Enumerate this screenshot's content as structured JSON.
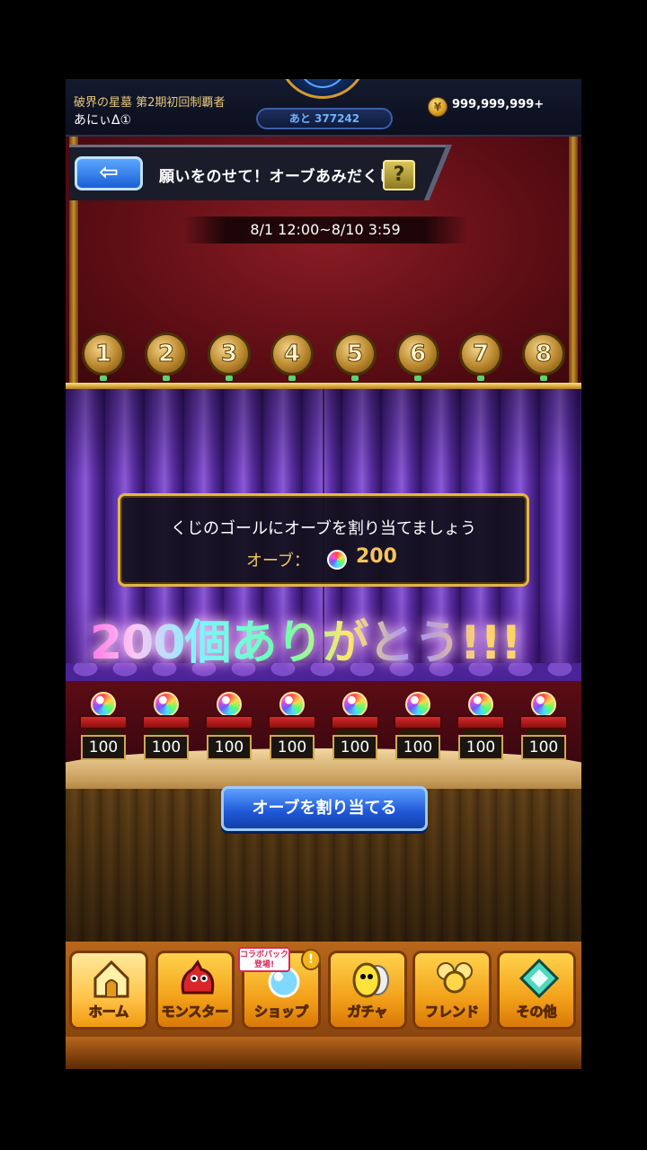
{
  "status_bar": {
    "title": "破界の星墓 第2期初回制覇者",
    "player_name": "あにぃΔ①",
    "remaining": "あと 377242",
    "coins": "999,999,999+"
  },
  "header": {
    "back_icon": "arrow-left-icon",
    "title": "願いをのせて！オーブあみだくじ",
    "help_label": "?"
  },
  "period": "8/1 12:00~8/10 3:59",
  "goal_numbers": [
    "1",
    "2",
    "3",
    "4",
    "5",
    "6",
    "7",
    "8"
  ],
  "message": {
    "line1": "くじのゴールにオーブを割り当てましょう",
    "orb_label": "オーブ：",
    "orb_count": "200"
  },
  "overlay_text": "200個ありがとう!!!",
  "goals": [
    "100",
    "100",
    "100",
    "100",
    "100",
    "100",
    "100",
    "100"
  ],
  "assign_button": "オーブを割り当てる",
  "nav": {
    "items": [
      {
        "label": "ホーム",
        "icon": "home-icon"
      },
      {
        "label": "モンスター",
        "icon": "monster-icon"
      },
      {
        "label": "ショップ",
        "icon": "shop-icon"
      },
      {
        "label": "ガチャ",
        "icon": "gacha-egg-icon"
      },
      {
        "label": "フレンド",
        "icon": "friend-icon"
      },
      {
        "label": "その他",
        "icon": "other-icon"
      }
    ],
    "collab_badge": "コラボパック登場!",
    "alert": "!"
  },
  "colors": {
    "accent_gold": "#e3b54a",
    "button_blue": "#1e56d6",
    "curtain_purple": "#6b3cb8",
    "nav_orange": "#f3a21a"
  }
}
